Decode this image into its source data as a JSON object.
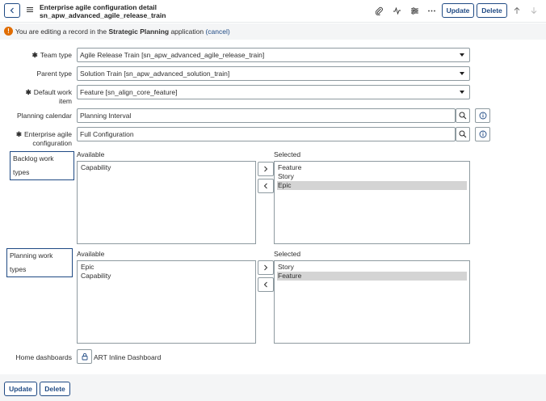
{
  "header": {
    "title": "Enterprise agile configuration detail",
    "subtitle": "sn_apw_advanced_agile_release_train",
    "update_label": "Update",
    "delete_label": "Delete",
    "icons": [
      "back-icon",
      "menu-icon",
      "paperclip-icon",
      "activity-icon",
      "settings-sliders-icon",
      "more-icon",
      "arrow-up-icon",
      "arrow-down-icon"
    ]
  },
  "notice": {
    "prefix": "You are editing a record in the ",
    "app_name": "Strategic Planning",
    "suffix": " application ",
    "cancel_label": "(cancel)"
  },
  "form": {
    "team_type": {
      "label": "Team type",
      "value": "Agile Release Train [sn_apw_advanced_agile_release_train]"
    },
    "parent_type": {
      "label": "Parent type",
      "value": "Solution Train [sn_apw_advanced_solution_train]"
    },
    "default_work_item": {
      "label_line1": "Default work",
      "label_line2": "item",
      "value": "Feature [sn_align_core_feature]"
    },
    "planning_calendar": {
      "label": "Planning calendar",
      "value": "Planning Interval"
    },
    "enterprise_agile_configuration": {
      "label_line1": "Enterprise agile",
      "label_line2": "configuration",
      "value": "Full Configuration"
    },
    "backlog_work_types": {
      "label": "Backlog work types",
      "available_header": "Available",
      "selected_header": "Selected",
      "available": [
        "Capability"
      ],
      "selected": [
        "Feature",
        "Story",
        "Epic"
      ],
      "highlighted": "Epic"
    },
    "planning_work_types": {
      "label": "Planning work types",
      "available_header": "Available",
      "selected_header": "Selected",
      "available": [
        "Epic",
        "Capability"
      ],
      "selected": [
        "Story",
        "Feature"
      ],
      "highlighted": "Feature"
    },
    "home_dashboards": {
      "label": "Home dashboards",
      "value": "ART Inline Dashboard"
    }
  },
  "footer": {
    "update_label": "Update",
    "delete_label": "Delete"
  },
  "colors": {
    "accent": "#1f4a84",
    "warning": "#e06c00",
    "selected_row": "#d4d4d4"
  }
}
